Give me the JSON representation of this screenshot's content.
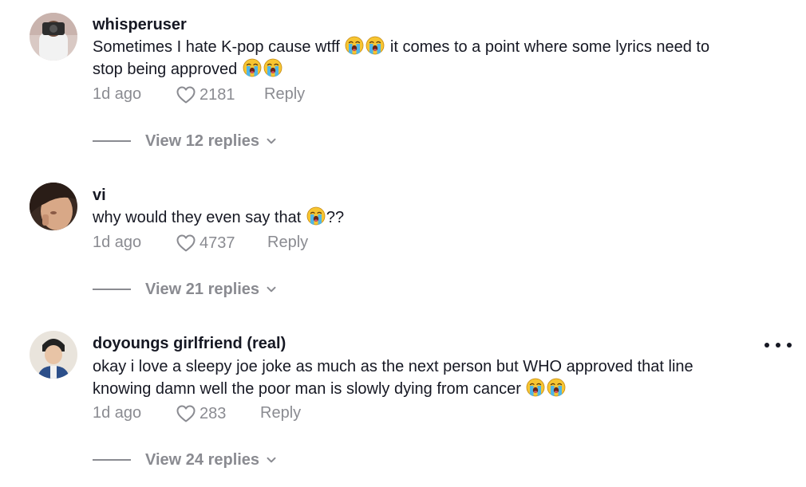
{
  "comments": [
    {
      "username": "whisperuser",
      "lines": [
        {
          "a": "Sometimes I hate K-pop cause wtff",
          "b": "it comes to a point where some lyrics need to"
        },
        {
          "a": "stop being approved",
          "b": ""
        }
      ],
      "time": "1d ago",
      "likes": "2181",
      "reply": "Reply",
      "view_replies": "View 12 replies"
    },
    {
      "username": "vi",
      "lines": [
        {
          "a": "why would they even say that",
          "b": "??"
        }
      ],
      "time": "1d ago",
      "likes": "4737",
      "reply": "Reply",
      "view_replies": "View 21 replies"
    },
    {
      "username": "doyoungs girlfriend (real)",
      "lines": [
        {
          "a": "okay i love a sleepy joe joke as much as the next person but WHO approved that line",
          "b": ""
        },
        {
          "a": "knowing damn well the poor man is slowly dying from cancer",
          "b": ""
        }
      ],
      "time": "1d ago",
      "likes": "283",
      "reply": "Reply",
      "view_replies": "View 24 replies"
    }
  ],
  "icons": {
    "emoji": "loudly-crying-face",
    "like": "heart-outline",
    "more": "more-horizontal-dots",
    "expand": "chevron-down"
  },
  "colors": {
    "text": "#161823",
    "secondary": "#8a8b91",
    "background": "#ffffff"
  }
}
